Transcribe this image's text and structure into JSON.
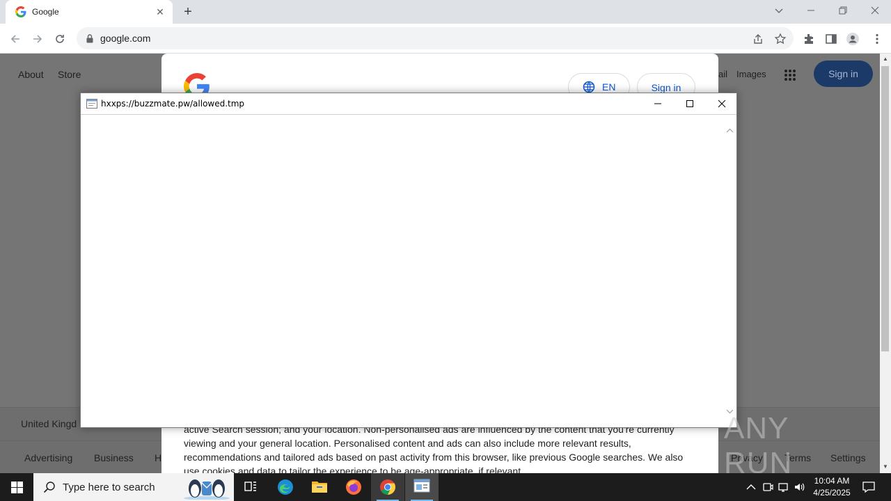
{
  "browser": {
    "tab_title": "Google",
    "url": "google.com"
  },
  "google": {
    "nav_left": [
      "About",
      "Store"
    ],
    "nav_right": [
      "Gmail",
      "Images"
    ],
    "nav_right_visible": [
      "ail",
      "Images"
    ],
    "sign_in_top": "Sign in",
    "lang_button": "EN",
    "consent_sign_in": "Sign in",
    "consent_text": "active Search session; and your location. Non-personalised ads are influenced by the content that you're currently viewing and your general location. Personalised content and ads can also include more relevant results, recommendations and tailored ads based on past activity from this browser, like previous Google searches. We also use cookies and data to tailor the experience to be age-appropriate, if relevant.",
    "footer_country": "United Kingdom",
    "footer_country_visible": "United Kingd",
    "footer_left": [
      "Advertising",
      "Business",
      "How Search works"
    ],
    "footer_left_visible": [
      "Advertising",
      "Business",
      "H"
    ],
    "footer_right": [
      "Privacy",
      "Terms",
      "Settings"
    ]
  },
  "popup": {
    "title": "hxxps://buzzmate.pw/allowed.tmp"
  },
  "watermark": "ANY RUN",
  "taskbar": {
    "search_placeholder": "Type here to search",
    "time": "10:04 AM",
    "date": "4/25/2025"
  },
  "colors": {
    "accent_blue": "#0b57d0",
    "dim_overlay": "#757575",
    "taskbar": "#1c1c1c"
  },
  "icons": [
    "google-favicon",
    "back-icon",
    "forward-icon",
    "reload-icon",
    "lock-icon",
    "share-icon",
    "star-icon",
    "extensions-icon",
    "side-panel-icon",
    "profile-icon",
    "menu-icon",
    "globe-icon",
    "apps-icon",
    "windows-start-icon",
    "search-icon",
    "task-view-icon",
    "edge-icon",
    "file-explorer-icon",
    "firefox-icon",
    "chrome-icon",
    "window-app-icon",
    "chevron-up-icon",
    "meet-icon",
    "network-icon",
    "volume-icon",
    "notification-icon"
  ]
}
